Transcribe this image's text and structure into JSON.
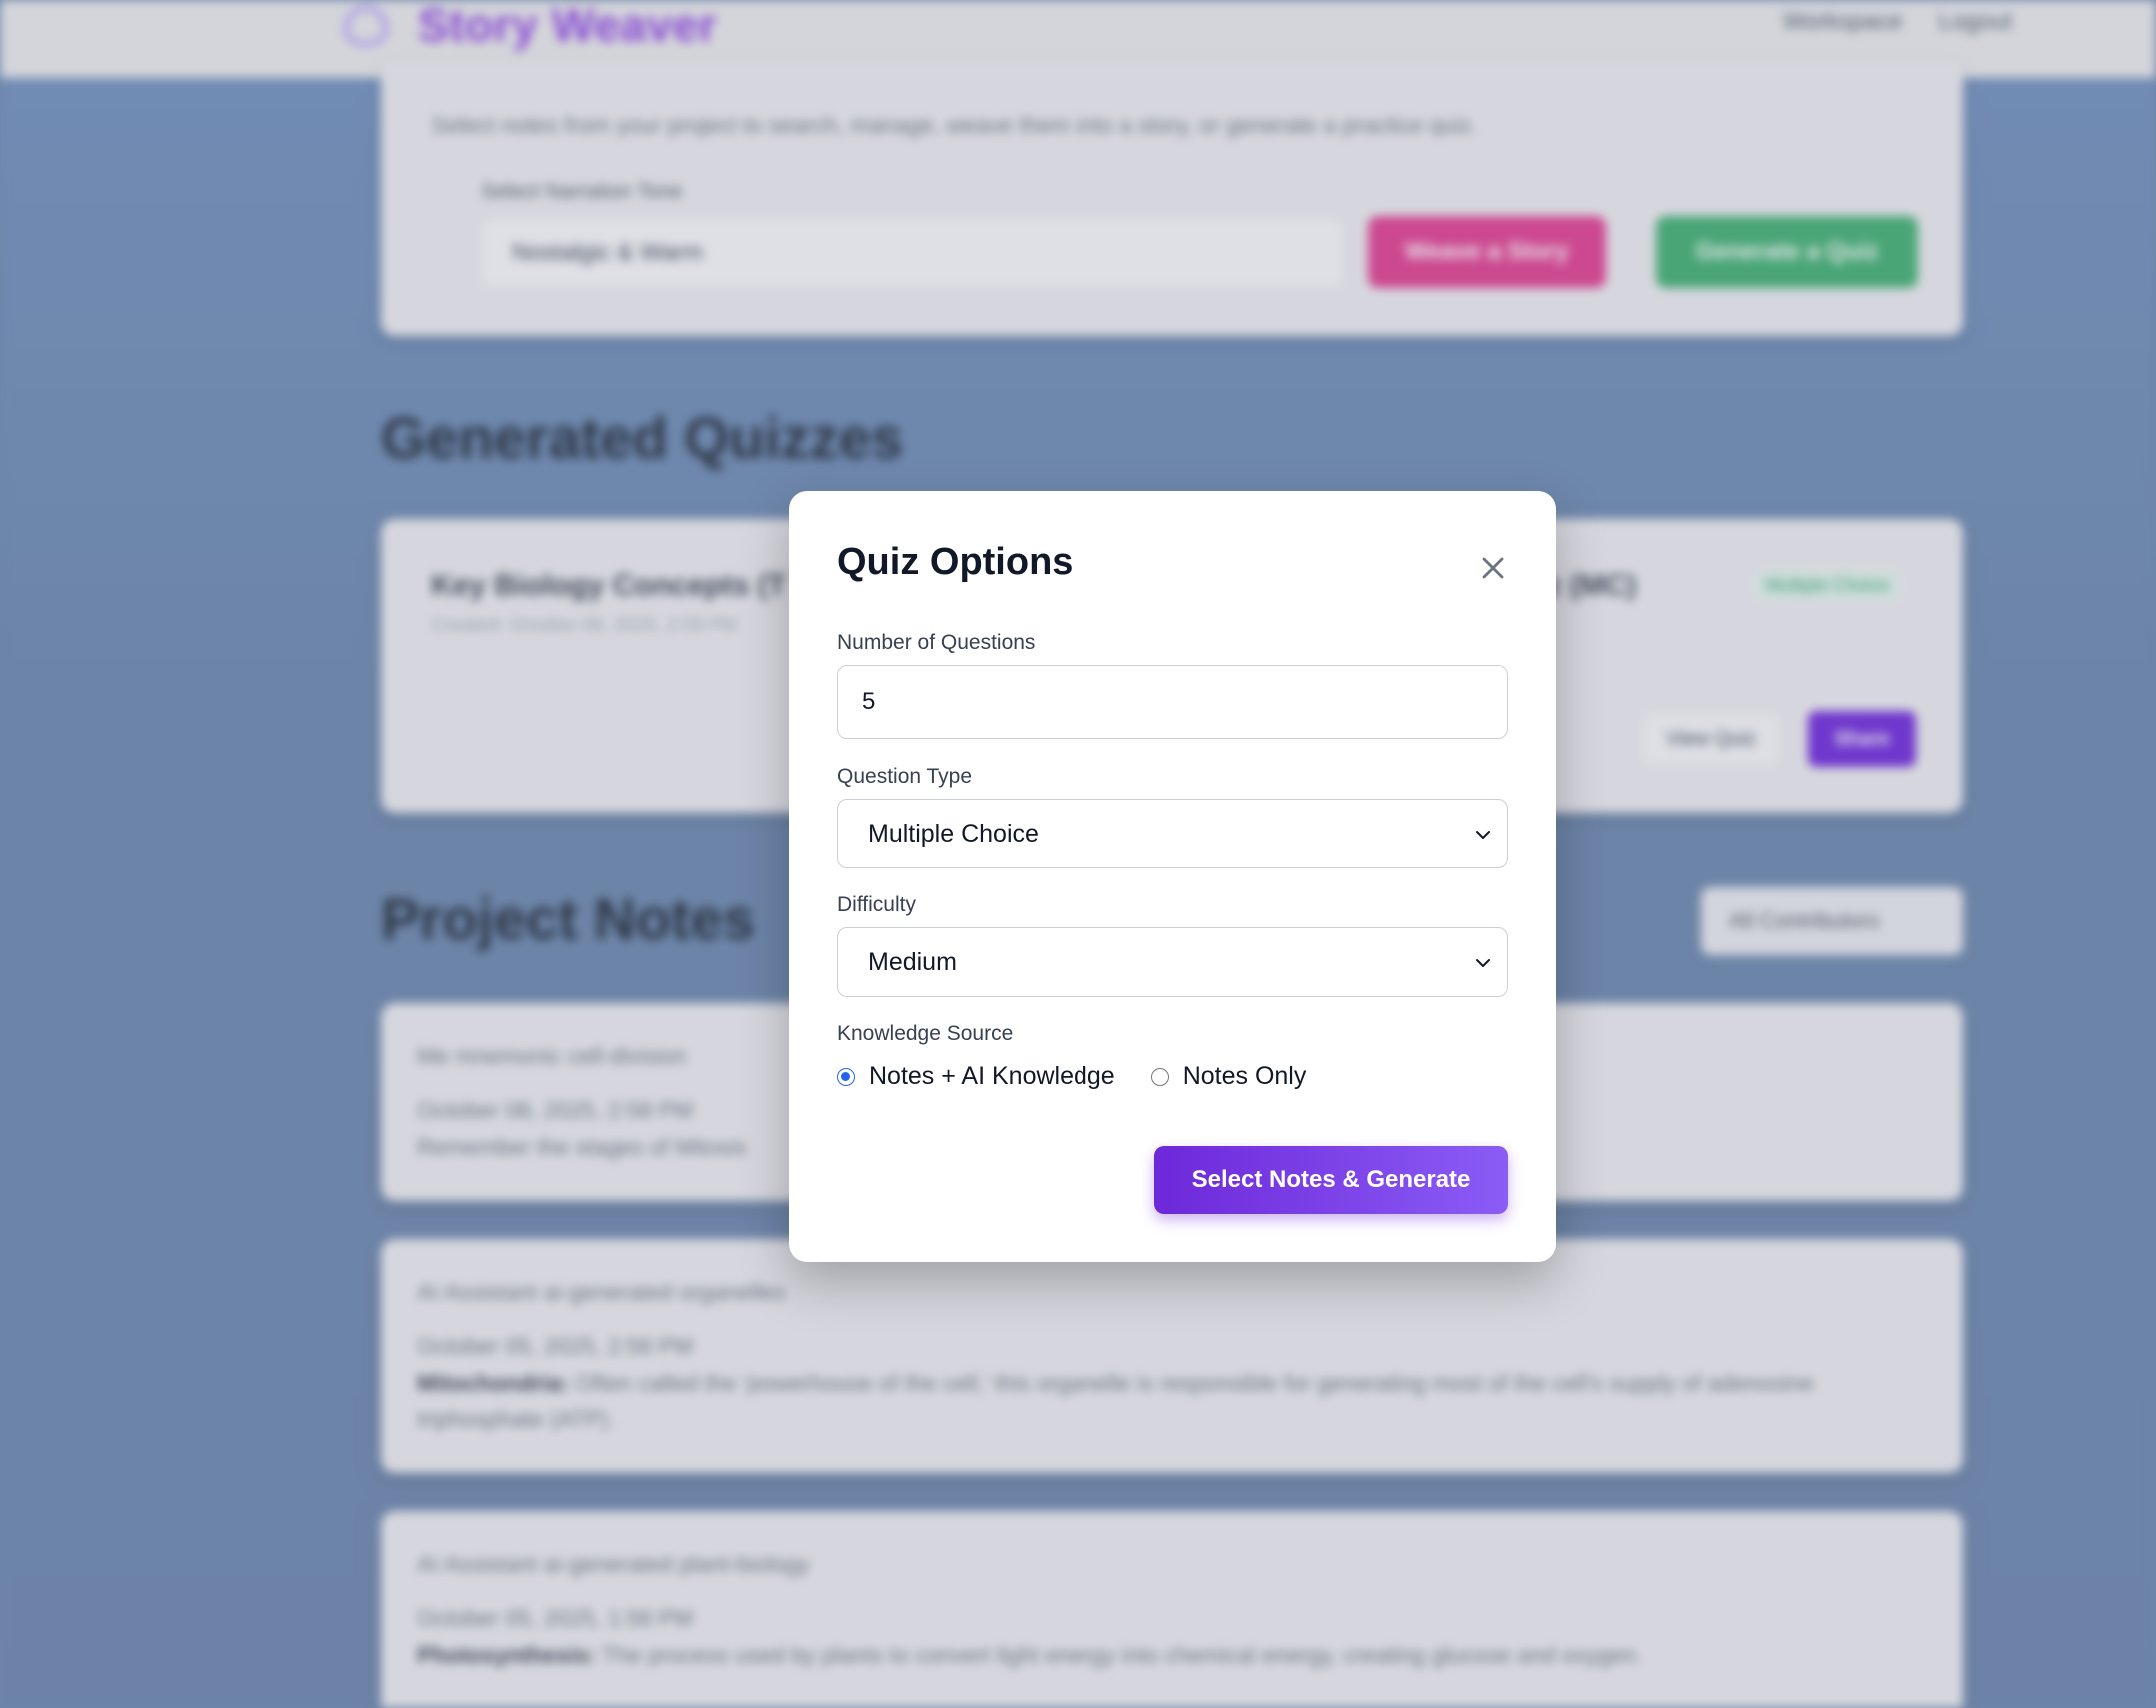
{
  "app": {
    "brand_name": "Story Weaver",
    "nav": [
      "Workspace",
      "Logout"
    ]
  },
  "background": {
    "top_card": {
      "description": "Select notes from your project to search, manage, weave them into a story, or generate a practice quiz.",
      "tone_label": "Select Narration Tone",
      "tone_value": "Nostalgic & Warm",
      "weave_button": "Weave a Story",
      "generate_quiz_button": "Generate a Quiz"
    },
    "quizzes_title": "Generated Quizzes",
    "quiz_card": {
      "title_left": "Key Biology Concepts (T",
      "created": "Created: October 08, 2025, 2:59 PM",
      "title_right": "iz (MC)",
      "badge": "Multiple Choice",
      "view_button": "View Quiz",
      "share_button": "Share"
    },
    "notes_title": "Project Notes",
    "contributors_select": "All Contributors",
    "notes": [
      {
        "meta": "Me  mnemonic  cell-division",
        "date": "October 08, 2025, 2:58 PM",
        "bold": "",
        "body": "Remember the stages of Mitosis"
      },
      {
        "meta": "AI Assistant  ai-generated  organelles",
        "date": "October 05, 2025, 2:58 PM",
        "bold": "Mitochondria:",
        "body": " Often called the 'powerhouse of the cell,' this organelle is responsible for generating most of the cell's supply of adenosine triphosphate (ATP)."
      },
      {
        "meta": "AI Assistant  ai-generated  plant-biology",
        "date": "October 05, 2025, 1:58 PM",
        "bold": "Photosynthesis:",
        "body": " The process used by plants to convert light energy into chemical energy, creating glucose and oxygen."
      }
    ]
  },
  "modal": {
    "title": "Quiz Options",
    "num_questions_label": "Number of Questions",
    "num_questions_value": "5",
    "question_type_label": "Question Type",
    "question_type_value": "Multiple Choice",
    "difficulty_label": "Difficulty",
    "difficulty_value": "Medium",
    "knowledge_source_label": "Knowledge Source",
    "knowledge_options": [
      "Notes + AI Knowledge",
      "Notes Only"
    ],
    "knowledge_selected": "Notes + AI Knowledge",
    "generate_button": "Select Notes & Generate"
  },
  "colors": {
    "accent_purple": "#6d28d9",
    "radio_blue": "#2563eb",
    "weave_pink": "#df3d8f",
    "quiz_green": "#3fae70"
  }
}
